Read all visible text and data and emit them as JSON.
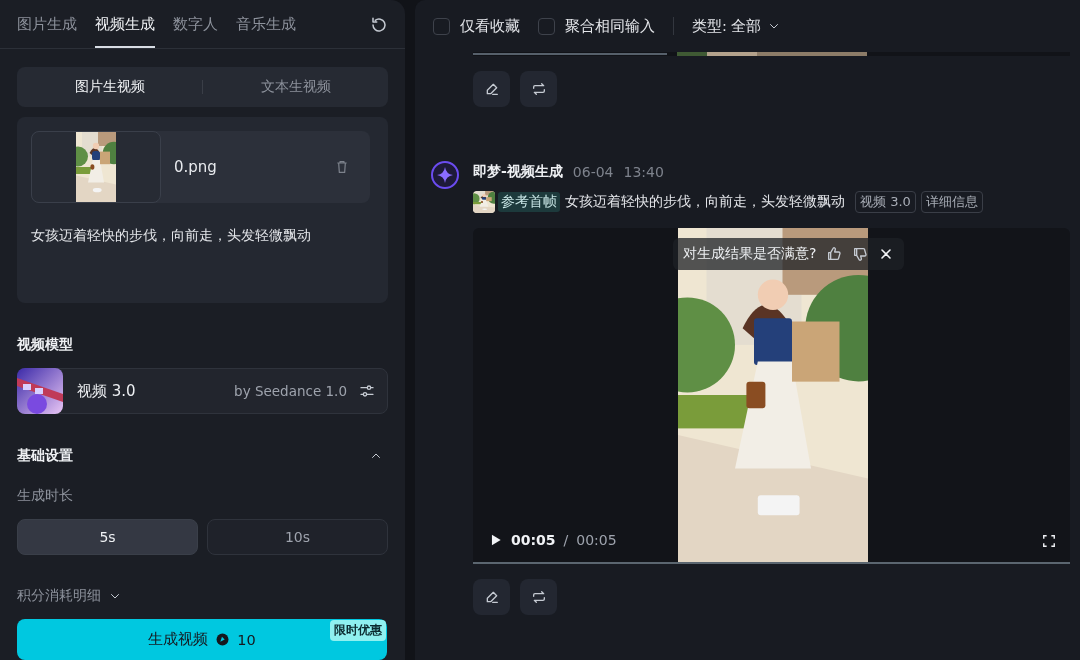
{
  "sidebar": {
    "tabs": [
      {
        "label": "图片生成",
        "selected": false
      },
      {
        "label": "视频生成",
        "selected": true
      },
      {
        "label": "数字人",
        "selected": false
      },
      {
        "label": "音乐生成",
        "selected": false
      }
    ],
    "mode_tabs": [
      {
        "label": "图片生视频",
        "selected": true
      },
      {
        "label": "文本生视频",
        "selected": false
      }
    ],
    "upload": {
      "file_name": "0.png"
    },
    "prompt": "女孩迈着轻快的步伐，向前走，头发轻微飘动",
    "model_section": {
      "title": "视频模型",
      "model_name": "视频 3.0",
      "provider": "by Seedance 1.0"
    },
    "basic_settings": {
      "title": "基础设置",
      "expanded": true,
      "duration_label": "生成时长",
      "durations": [
        {
          "label": "5s",
          "selected": true
        },
        {
          "label": "10s",
          "selected": false
        }
      ]
    },
    "cost_details": {
      "label": "积分消耗明细",
      "expanded": false
    },
    "generate_button": {
      "label": "生成视频",
      "cost": "10",
      "badge": "限时优惠"
    }
  },
  "feed": {
    "filters": [
      {
        "label": "仅看收藏",
        "checked": false
      },
      {
        "label": "聚合相同输入",
        "checked": false
      }
    ],
    "type_filter": "类型: 全部",
    "entries": [
      {
        "kind": "partial"
      },
      {
        "kind": "full",
        "author": "即梦-视频生成",
        "date": "06-04",
        "time": "13:40",
        "ref_label": "参考首帧",
        "prompt": "女孩迈着轻快的步伐，向前走，头发轻微飘动",
        "tags": [
          "视频 3.0",
          "详细信息"
        ],
        "video": {
          "feedback": "对生成结果是否满意?",
          "current_time": "00:05",
          "separator": "/",
          "duration": "00:05",
          "level": 1
        }
      }
    ]
  }
}
